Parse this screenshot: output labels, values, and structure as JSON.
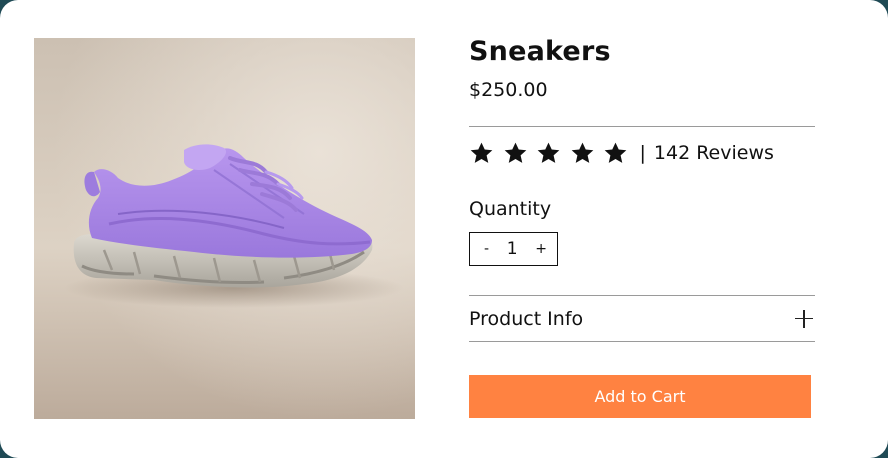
{
  "product": {
    "title": "Sneakers",
    "price": "$250.00",
    "image": "purple-sneaker-photo",
    "rating": {
      "stars": 5,
      "max": 5,
      "divider": "|",
      "reviews": "142 Reviews"
    },
    "quantity": {
      "label": "Quantity",
      "value": "1",
      "decrement": "-",
      "increment": "+"
    },
    "accordion": {
      "label": "Product Info",
      "icon": "plus-icon"
    },
    "cta": {
      "label": "Add to Cart",
      "color": "#ff8241"
    }
  },
  "colors": {
    "accent": "#ff8241",
    "text": "#111111",
    "page_background": "#1f4a55",
    "sneaker_upper": "#a886e6"
  }
}
